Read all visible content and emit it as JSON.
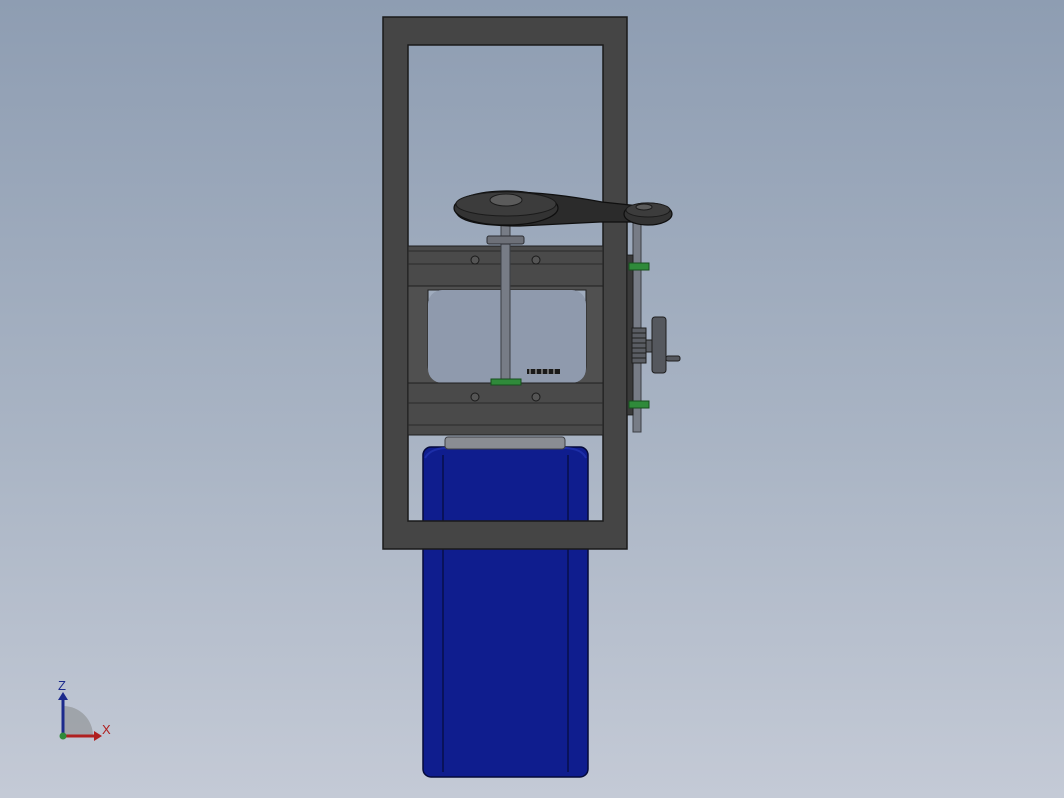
{
  "viewport": {
    "background_top": "#8e9db2",
    "background_bottom": "#c4cad6"
  },
  "model": {
    "frame_color": "#454545",
    "motor_color": "#0f1d8e",
    "belt_color": "#2b2b2b",
    "shaft_color": "#777c86",
    "bearing_color": "#2f8a3a"
  },
  "triad": {
    "z_label": "Z",
    "x_label": "X",
    "z_color": "#1c2a8c",
    "x_color": "#b02020",
    "y_color": "#2f8a3a"
  }
}
